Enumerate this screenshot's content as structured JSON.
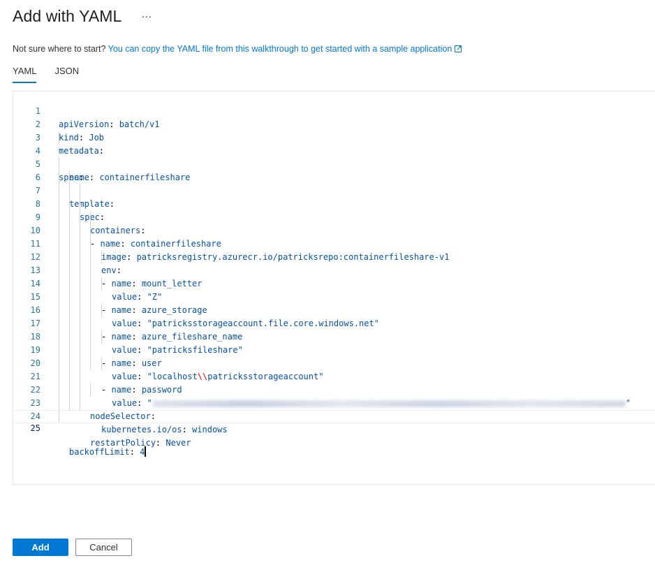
{
  "header": {
    "title": "Add with YAML",
    "more": "···"
  },
  "intro": {
    "text": "Not sure where to start?",
    "link": "You can copy the YAML file from this walkthrough to get started with a sample application"
  },
  "tabs": [
    {
      "label": "YAML",
      "active": true
    },
    {
      "label": "JSON",
      "active": false
    }
  ],
  "editor": {
    "current_line": 25,
    "lines": [
      {
        "num": "1",
        "key": "apiVersion",
        "value": "batch/v1"
      },
      {
        "num": "2",
        "key": "kind",
        "value": "Job"
      },
      {
        "num": "3",
        "key": "metadata",
        "value": ""
      },
      {
        "num": "4",
        "key": "name",
        "value": "containerfileshare"
      },
      {
        "num": "5",
        "key": "spec",
        "value": ""
      },
      {
        "num": "6",
        "key": "template",
        "value": ""
      },
      {
        "num": "7",
        "key": "spec",
        "value": ""
      },
      {
        "num": "8",
        "key": "containers",
        "value": ""
      },
      {
        "num": "9",
        "key": "name",
        "value": "containerfileshare"
      },
      {
        "num": "10",
        "key": "image",
        "value": "patricksregistry.azurecr.io/patricksrepo:containerfileshare-v1"
      },
      {
        "num": "11",
        "key": "env",
        "value": ""
      },
      {
        "num": "12",
        "key": "name",
        "value": "mount_letter"
      },
      {
        "num": "13",
        "key": "value",
        "value": "\"Z\""
      },
      {
        "num": "14",
        "key": "name",
        "value": "azure_storage"
      },
      {
        "num": "15",
        "key": "value",
        "value": "\"patricksstorageaccount.file.core.windows.net\""
      },
      {
        "num": "16",
        "key": "name",
        "value": "azure_fileshare_name"
      },
      {
        "num": "17",
        "key": "value",
        "value": "\"patricksfileshare\""
      },
      {
        "num": "18",
        "key": "name",
        "value": "user"
      },
      {
        "num": "19",
        "key": "value",
        "value": ""
      },
      {
        "num": "20",
        "key": "name",
        "value": "password"
      },
      {
        "num": "21",
        "key": "value",
        "value": ""
      },
      {
        "num": "22",
        "key": "nodeSelector",
        "value": ""
      },
      {
        "num": "23",
        "key": "kubernetes.io/os",
        "value": "windows"
      },
      {
        "num": "24",
        "key": "restartPolicy",
        "value": "Never"
      },
      {
        "num": "25",
        "key": "backoffLimit",
        "value": "4"
      }
    ],
    "line19_pre": "\"localhost",
    "line19_escape": "\\\\",
    "line19_post": "patricksstorageaccount\"",
    "line21_open": "\"",
    "line21_close": "\""
  },
  "footer": {
    "add_label": "Add",
    "cancel_label": "Cancel"
  },
  "colors": {
    "accent": "#0078d4",
    "yaml_value": "#0451a5",
    "line_number": "#237893",
    "escape": "#ee0000"
  }
}
